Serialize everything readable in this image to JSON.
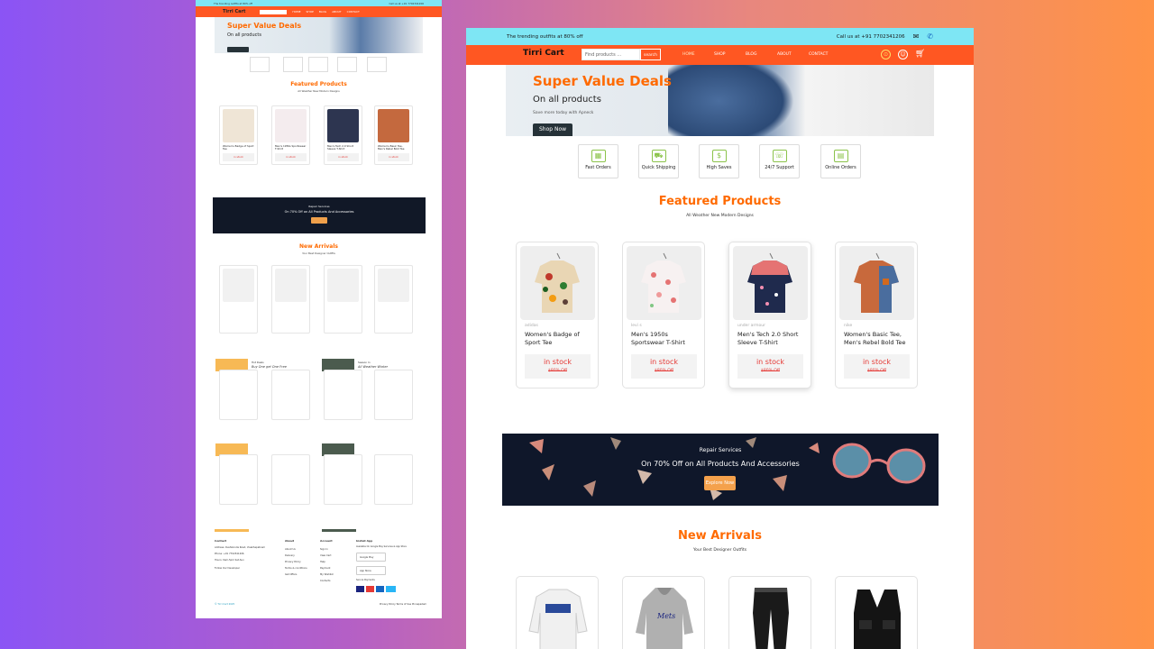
{
  "site": {
    "topbar_text": "The trending outfits at 80% off",
    "call_text": "Call us at +91 7702341206",
    "brand": "Tirri Cart",
    "search_placeholder": "Find products ...",
    "search_button": "search",
    "nav": [
      "HOME",
      "SHOP",
      "BLOG",
      "ABOUT",
      "CONTACT"
    ],
    "hero": {
      "title": "Super Value Deals",
      "subtitle": "On all products",
      "tagline": "Save more today with Apneck",
      "button": "Shop Now"
    },
    "features": [
      "Fast Orders",
      "Quick Shipping",
      "High Saves",
      "24/7 Support",
      "Online Orders"
    ],
    "featured": {
      "title": "Featured Products",
      "subtitle": "All Weather New Modern Designs"
    },
    "products": [
      {
        "brand": "adidas",
        "name": "Women's Badge of Sport Tee",
        "stock": "in stock",
        "price": "$80% Off"
      },
      {
        "brand": "levi s",
        "name": "Men's 1950s Sportswear T-Shirt",
        "stock": "in stock",
        "price": "$80% Off"
      },
      {
        "brand": "under armour",
        "name": "Men's Tech 2.0 Short Sleeve T-Shirt",
        "stock": "in stock",
        "price": "$80% Off"
      },
      {
        "brand": "nike",
        "name": "Women's Basic Tee, Men's Rebel Bold Tee",
        "stock": "in stock",
        "price": "$80% Off"
      }
    ],
    "promo": {
      "label": "Repair Services",
      "headline": "On 70% Off on All Products And Accessories",
      "button": "Explore Now"
    },
    "arrivals": {
      "title": "New Arrivals",
      "subtitle": "Your Best Designer Outfits"
    }
  },
  "mini": {
    "topbar_text": "The trending outfits at 80% off",
    "call_text": "Call us at +91 7702341206",
    "brand": "Tirri Cart",
    "hero_title": "Super Value Deals",
    "hero_sub": "On all products",
    "featured_title": "Featured Products",
    "featured_sub": "All Weather New Modern Designs",
    "promo_label": "Repair Services",
    "promo_headline": "On 70% Off on All Products And Accessories",
    "arrivals_title": "New Arrivals",
    "arrivals_sub": "Your Best Designer Outfits",
    "deal1_label": "Hot Deals",
    "deal1_title": "Buy One get One Free",
    "deal2_label": "Season In",
    "deal2_title": "All Weather Winter",
    "footer": {
      "contact": "Contact",
      "about": "About",
      "account": "Account",
      "install": "Install App",
      "address": "Address: Rushikonda Road, Visakhapatnam",
      "phone": "Phone: +91 7702341206",
      "hours": "Hours: 9am-5pm Sat-Sun",
      "follow": "Follow Our Developer",
      "about_links": [
        "About Us",
        "Delivery",
        "Privacy Policy",
        "Terms & conditions",
        "Get Offers"
      ],
      "account_links": [
        "Sign In",
        "View Cart",
        "Help",
        "Payment",
        "My Wishlist",
        "Contacts"
      ],
      "app_text": "Available On Google Play Services & App Store",
      "google": "Google Play",
      "apple": "App Store",
      "pay_text": "Secure Payments",
      "copyright": "© Tirri Cart 2025",
      "legal": "Privacy Policy  Terms of Use  Pinnapadam"
    }
  }
}
